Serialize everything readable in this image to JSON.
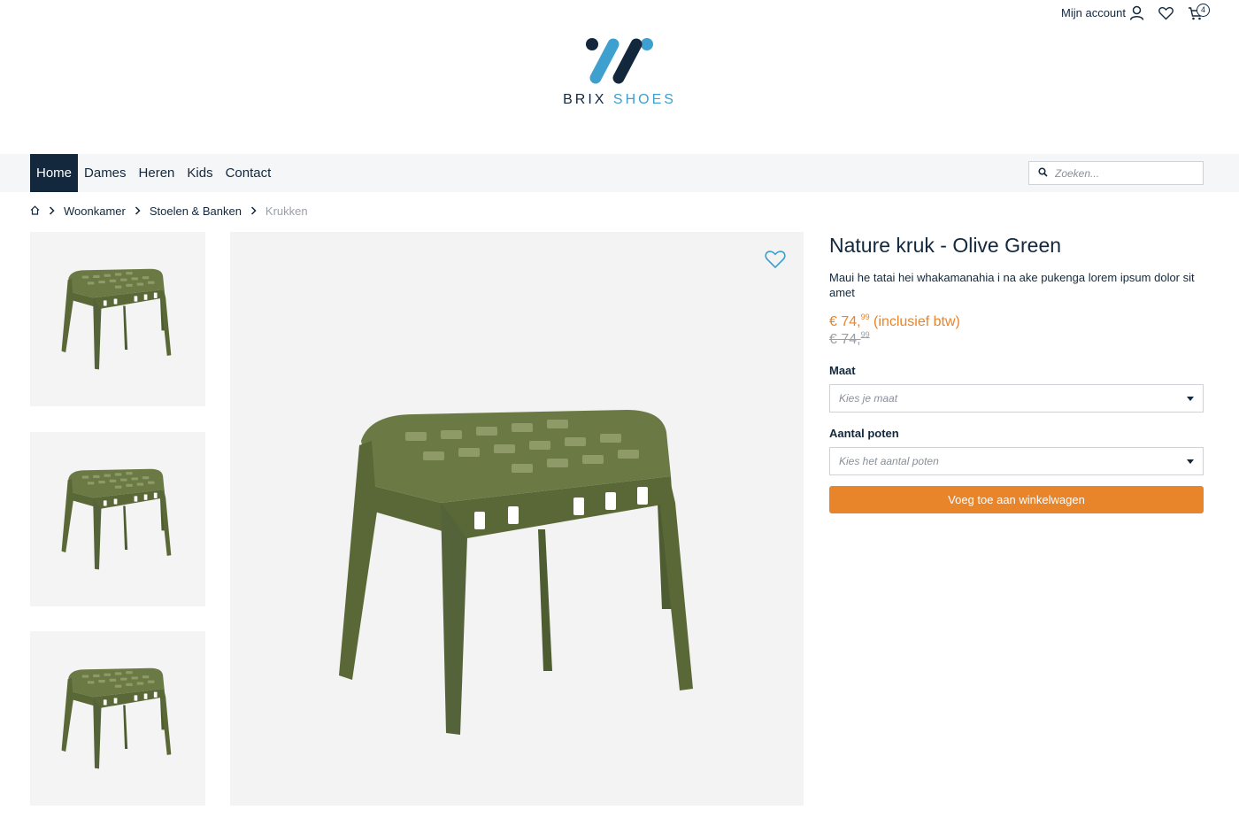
{
  "colors": {
    "navy": "#13283d",
    "accent_blue": "#3ea0cf",
    "orange": "#e8842a",
    "olive": "#5b6a3c"
  },
  "topbar": {
    "account_label": "Mijn account",
    "account_icon": "user-icon",
    "wishlist_icon": "heart-icon",
    "cart_icon": "cart-icon",
    "cart_count": "4"
  },
  "logo": {
    "word1": "BRIX",
    "word2": "SHOES"
  },
  "nav": {
    "items": [
      {
        "label": "Home",
        "active": true
      },
      {
        "label": "Dames"
      },
      {
        "label": "Heren"
      },
      {
        "label": "Kids"
      },
      {
        "label": "Contact"
      }
    ],
    "search_placeholder": "Zoeken..."
  },
  "breadcrumb": {
    "home_icon": "home-icon",
    "items": [
      "Woonkamer",
      "Stoelen & Banken"
    ],
    "current": "Krukken"
  },
  "product": {
    "title": "Nature kruk - Olive Green",
    "description": "Maui he tatai hei whakamanahia i na ake pukenga lorem ipsum dolor sit amet",
    "price_main": "€ 74,",
    "price_cents": "99",
    "price_suffix": " (inclusief btw)",
    "old_price_main": "€ 74,",
    "old_price_cents": "99",
    "size_label": "Maat",
    "size_placeholder": "Kies je maat",
    "legs_label": "Aantal poten",
    "legs_placeholder": "Kies het aantal poten",
    "add_to_cart": "Voeg toe aan winkelwagen"
  }
}
